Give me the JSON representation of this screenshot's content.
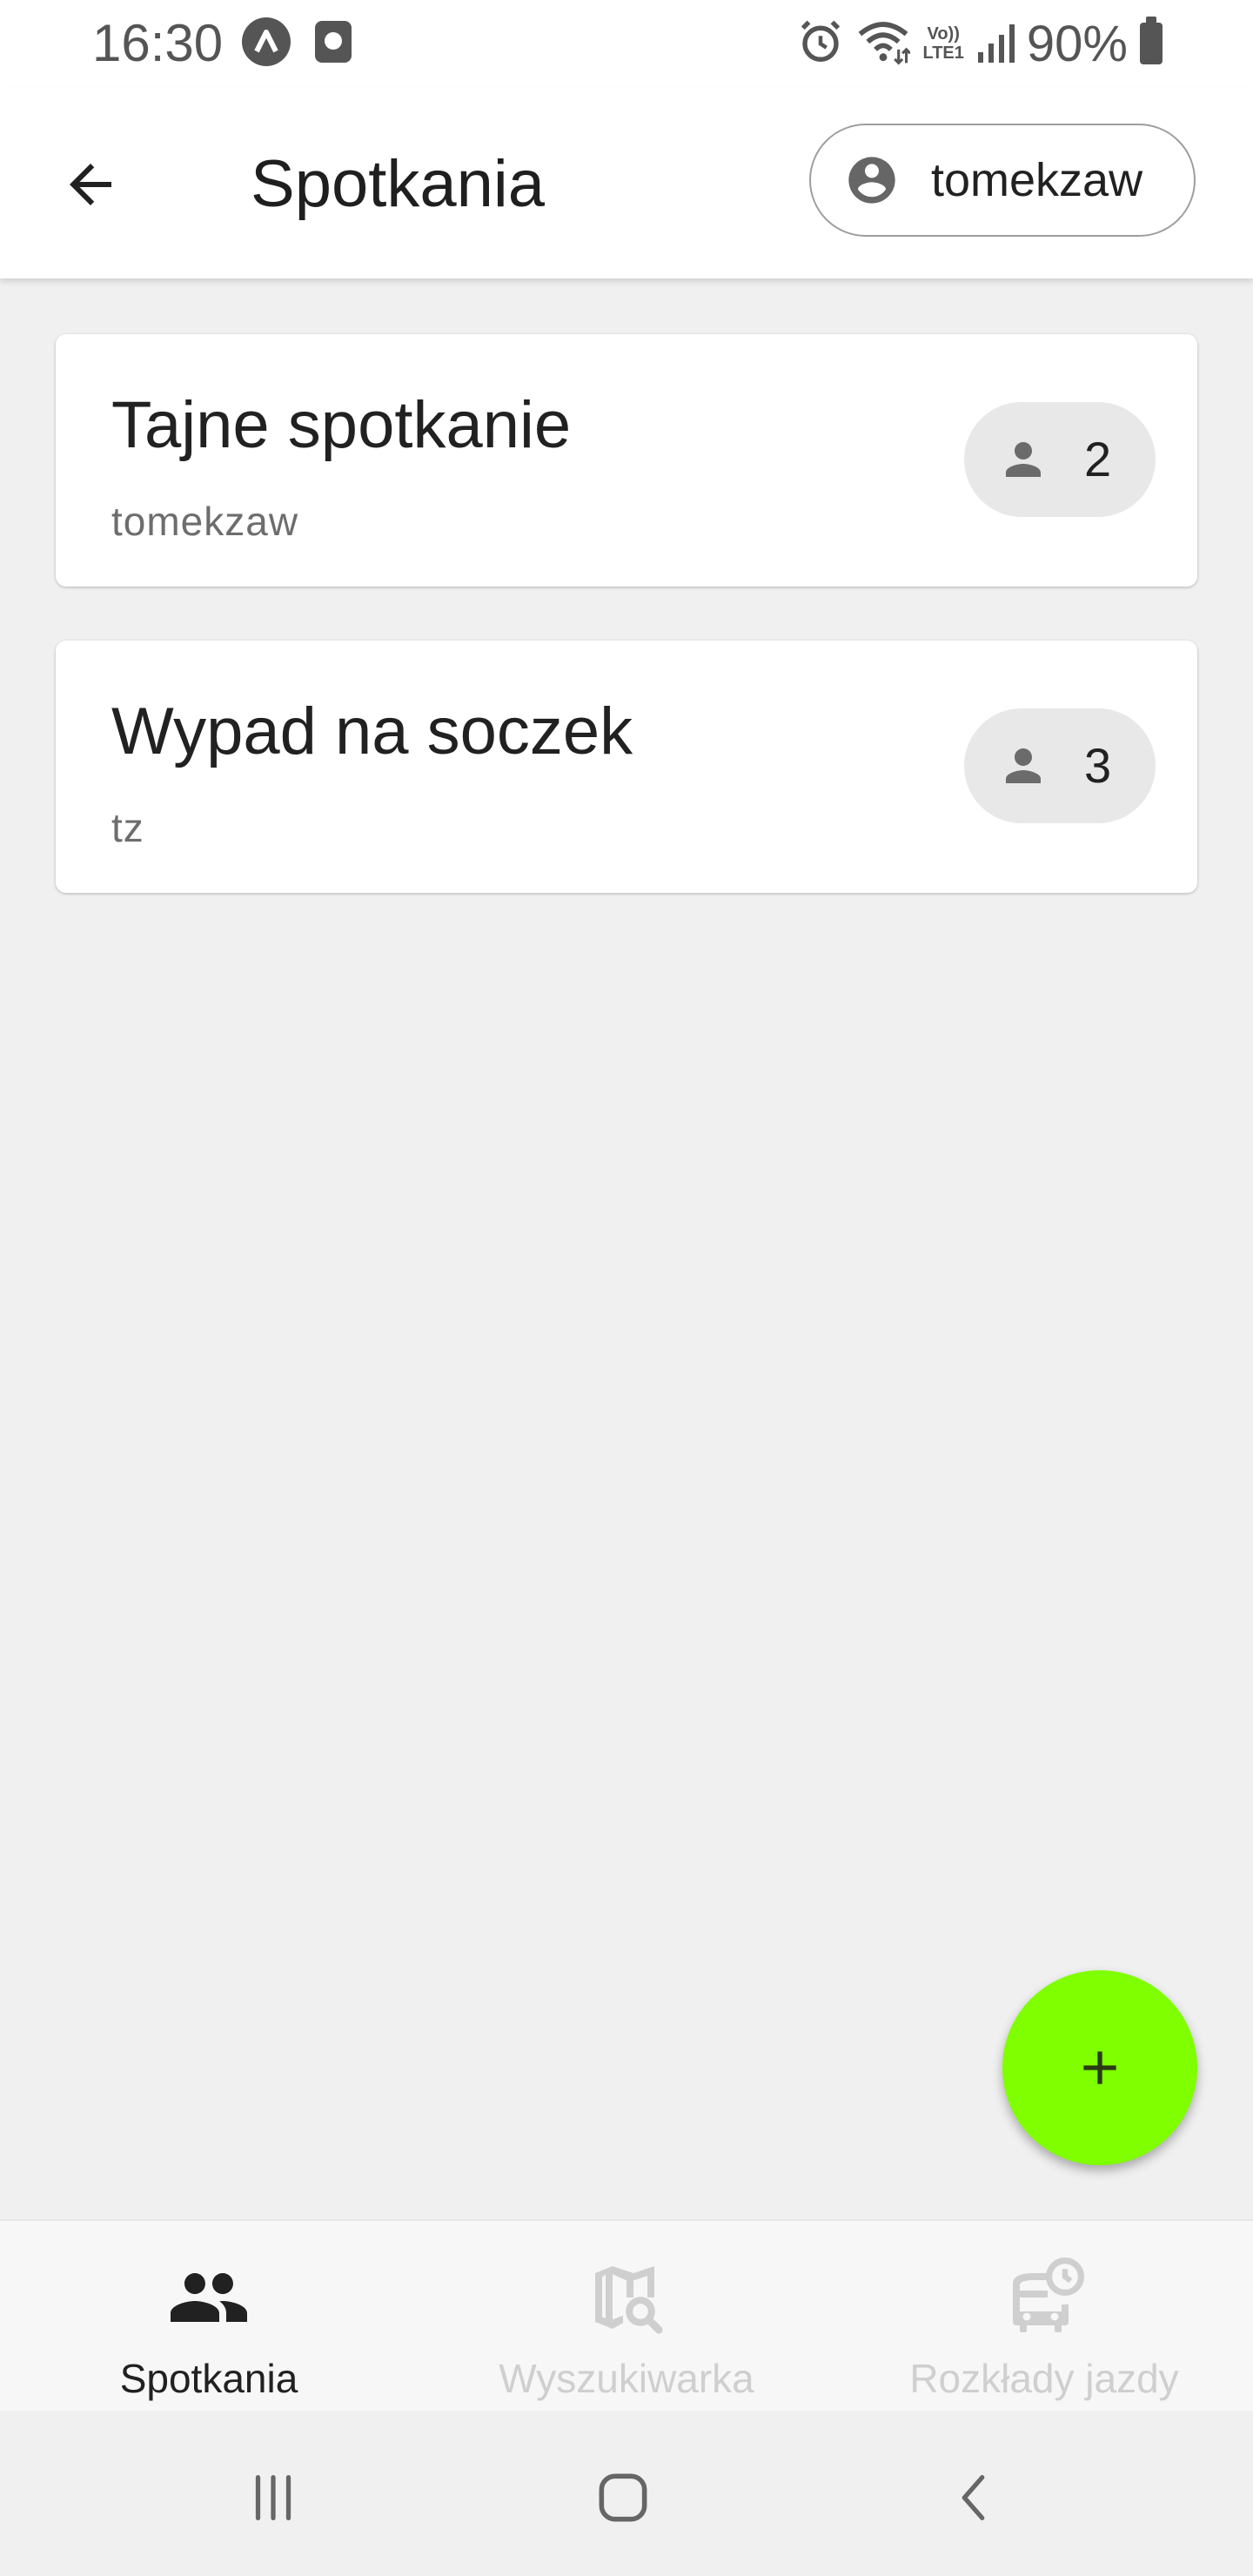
{
  "status_bar": {
    "time": "16:30",
    "battery_percent": "90%",
    "volte_top": "Vo))",
    "volte_bottom": "LTE1",
    "icons": [
      "app-notification-icon",
      "screen-notification-icon",
      "alarm-icon",
      "wifi-icon",
      "volte-icon",
      "signal-icon",
      "battery-icon"
    ]
  },
  "app_bar": {
    "title": "Spotkania",
    "back_icon": "arrow-back-icon",
    "user_chip": {
      "label": "tomekzaw",
      "icon": "account-circle-icon"
    }
  },
  "meetings": [
    {
      "title": "Tajne spotkanie",
      "owner": "tomekzaw",
      "members": "2"
    },
    {
      "title": "Wypad na soczek",
      "owner": "tz",
      "members": "3"
    }
  ],
  "fab": {
    "icon": "plus-icon",
    "color": "#7fff00"
  },
  "bottom_nav": {
    "items": [
      {
        "label": "Spotkania",
        "icon": "people-icon",
        "active": true
      },
      {
        "label": "Wyszukiwarka",
        "icon": "map-search-icon",
        "active": false
      },
      {
        "label": "Rozkłady jazdy",
        "icon": "bus-clock-icon",
        "active": false
      }
    ]
  },
  "system_nav": {
    "icons": [
      "recent-apps-icon",
      "home-icon",
      "back-icon"
    ]
  },
  "colors": {
    "accent": "#7fff00",
    "background": "#f0f0f0",
    "surface": "#ffffff",
    "inactive": "#cfcfcf"
  }
}
